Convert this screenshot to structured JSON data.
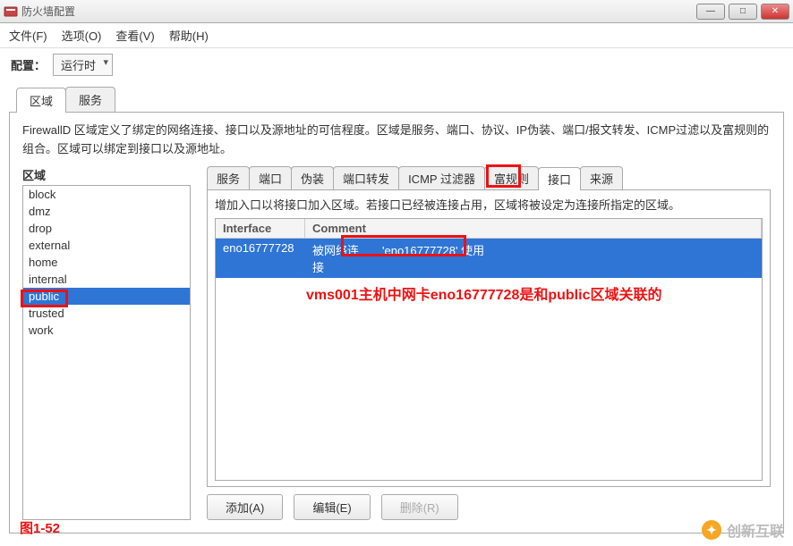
{
  "window": {
    "title": "防火墙配置"
  },
  "menu": {
    "file": "文件(F)",
    "options": "选项(O)",
    "view": "查看(V)",
    "help": "帮助(H)"
  },
  "config": {
    "label": "配置：",
    "value": "运行时"
  },
  "outer_tabs": {
    "zone": "区域",
    "service": "服务"
  },
  "description": "FirewallD 区域定义了绑定的网络连接、接口以及源地址的可信程度。区域是服务、端口、协议、IP伪装、端口/报文转发、ICMP过滤以及富规则的组合。区域可以绑定到接口以及源地址。",
  "zone": {
    "label": "区域",
    "items": [
      "block",
      "dmz",
      "drop",
      "external",
      "home",
      "internal",
      "public",
      "trusted",
      "work"
    ],
    "selected": "public"
  },
  "inner_tabs": {
    "service": "服务",
    "port": "端口",
    "masq": "伪装",
    "portfwd": "端口转发",
    "icmp": "ICMP 过滤器",
    "rich": "富规则",
    "iface": "接口",
    "source": "来源"
  },
  "iface_panel": {
    "desc": "增加入口以将接口加入区域。若接口已经被连接占用，区域将被设定为连接所指定的区域。",
    "col_iface": "Interface",
    "col_comment": "Comment",
    "row_iface": "eno16777728",
    "row_comment_a": "被网络连接",
    "row_comment_b": "'eno16777728' 使用"
  },
  "buttons": {
    "add": "添加(A)",
    "edit": "编辑(E)",
    "delete": "删除(R)"
  },
  "caption": "图1-52",
  "annotation_text": "vms001主机中网卡eno16777728是和public区域关联的",
  "watermark": "创新互联"
}
